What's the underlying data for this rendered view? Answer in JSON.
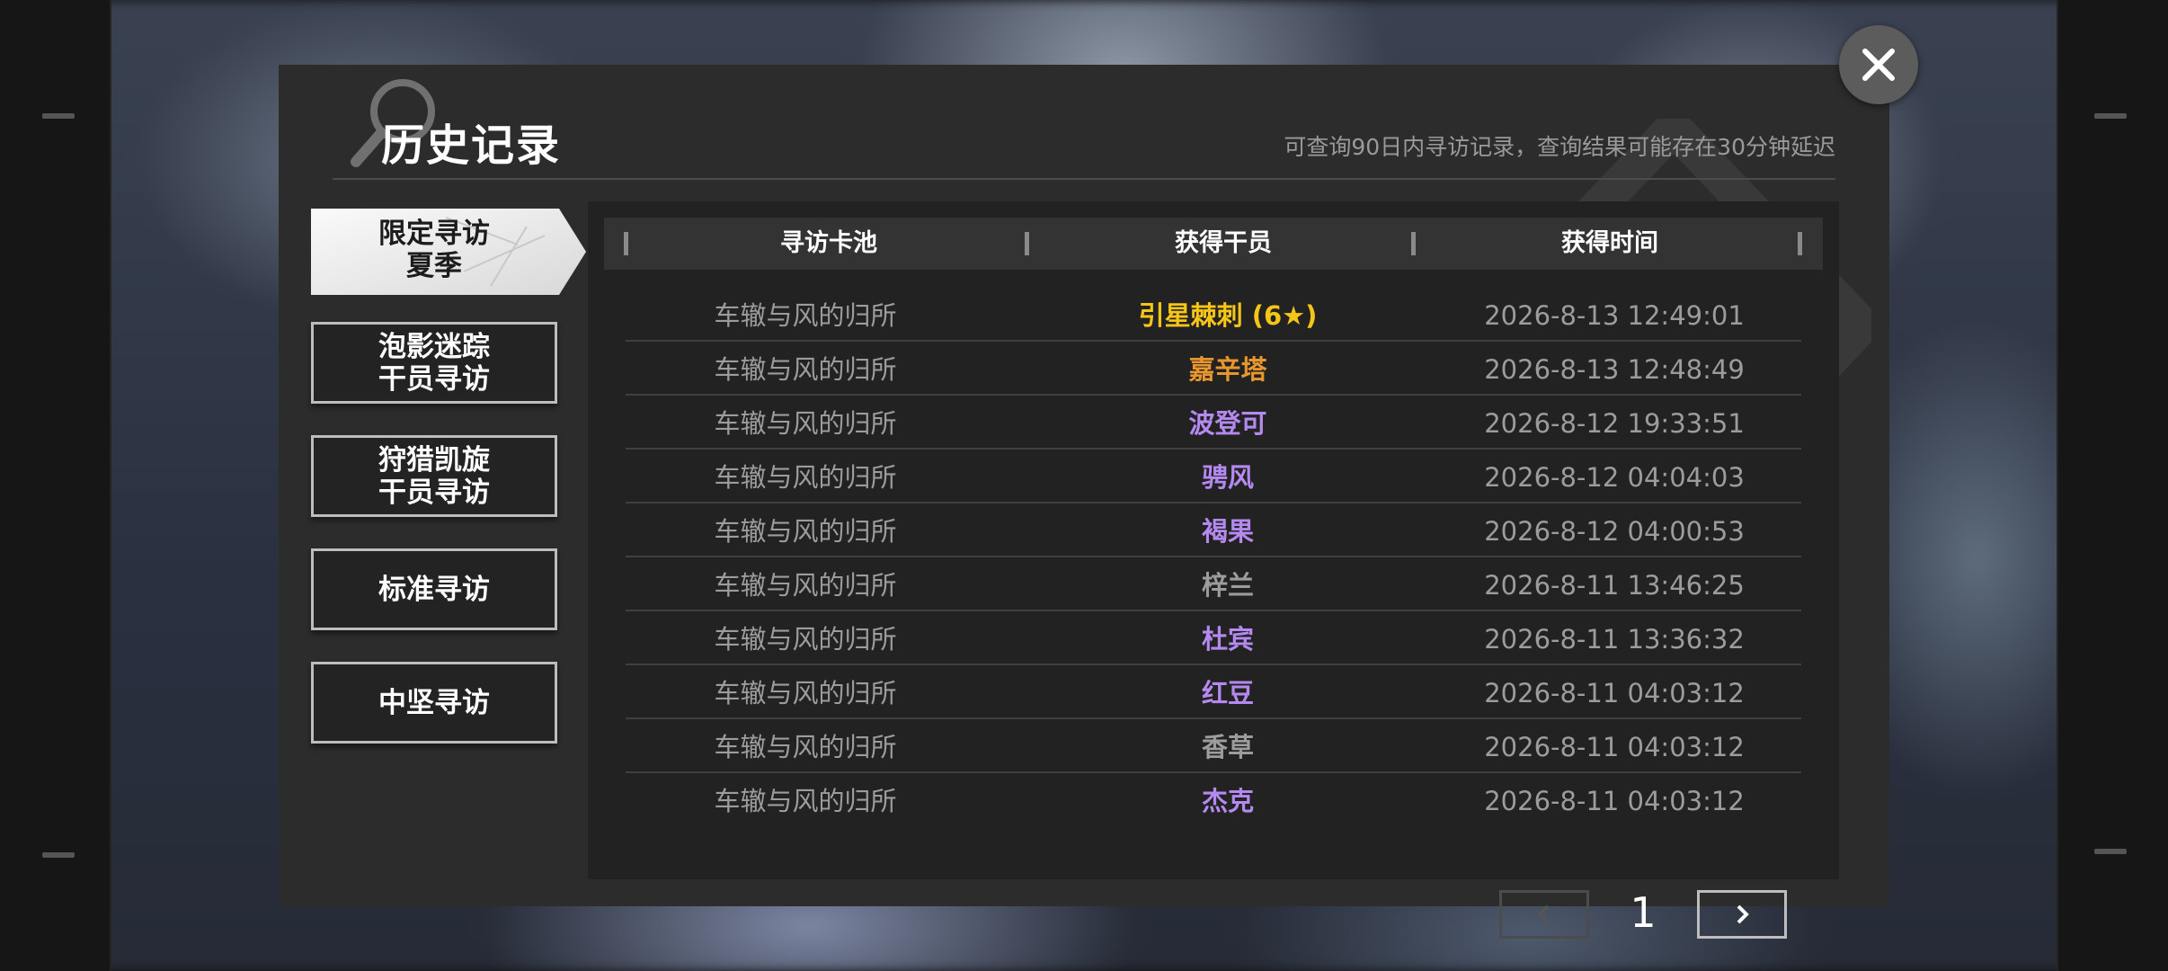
{
  "dialog": {
    "title": "历史记录",
    "subtitle": "可查询90日内寻访记录，查询结果可能存在30分钟延迟"
  },
  "icons": {
    "close": "close-icon",
    "search_watermark": "magnifier-icon",
    "prev": "chevron-left-icon",
    "next": "chevron-right-icon"
  },
  "nav": [
    {
      "label": "限定寻访\n夏季",
      "active": true
    },
    {
      "label": "泡影迷踪\n干员寻访",
      "active": false
    },
    {
      "label": "狩猎凯旋\n干员寻访",
      "active": false
    },
    {
      "label": "标准寻访",
      "active": false
    },
    {
      "label": "中坚寻访",
      "active": false
    }
  ],
  "table": {
    "headers": [
      "寻访卡池",
      "获得干员",
      "获得时间"
    ],
    "rows": [
      {
        "pool": "车辙与风的归所",
        "operator": "引星棘刺 (6★)",
        "time": "2026-8-13 12:49:01",
        "color": "#f5c518"
      },
      {
        "pool": "车辙与风的归所",
        "operator": "嘉辛塔",
        "time": "2026-8-13 12:48:49",
        "color": "#e8962e"
      },
      {
        "pool": "车辙与风的归所",
        "operator": "波登可",
        "time": "2026-8-12 19:33:51",
        "color": "#b58af0"
      },
      {
        "pool": "车辙与风的归所",
        "operator": "骋风",
        "time": "2026-8-12 04:04:03",
        "color": "#b58af0"
      },
      {
        "pool": "车辙与风的归所",
        "operator": "褐果",
        "time": "2026-8-12 04:00:53",
        "color": "#b58af0"
      },
      {
        "pool": "车辙与风的归所",
        "operator": "梓兰",
        "time": "2026-8-11 13:46:25",
        "color": "#9c9c9c"
      },
      {
        "pool": "车辙与风的归所",
        "operator": "杜宾",
        "time": "2026-8-11 13:36:32",
        "color": "#b58af0"
      },
      {
        "pool": "车辙与风的归所",
        "operator": "红豆",
        "time": "2026-8-11 04:03:12",
        "color": "#b58af0"
      },
      {
        "pool": "车辙与风的归所",
        "operator": "香草",
        "time": "2026-8-11 04:03:12",
        "color": "#9c9c9c"
      },
      {
        "pool": "车辙与风的归所",
        "operator": "杰克",
        "time": "2026-8-11 04:03:12",
        "color": "#b58af0"
      }
    ]
  },
  "pager": {
    "current_page": "1"
  }
}
